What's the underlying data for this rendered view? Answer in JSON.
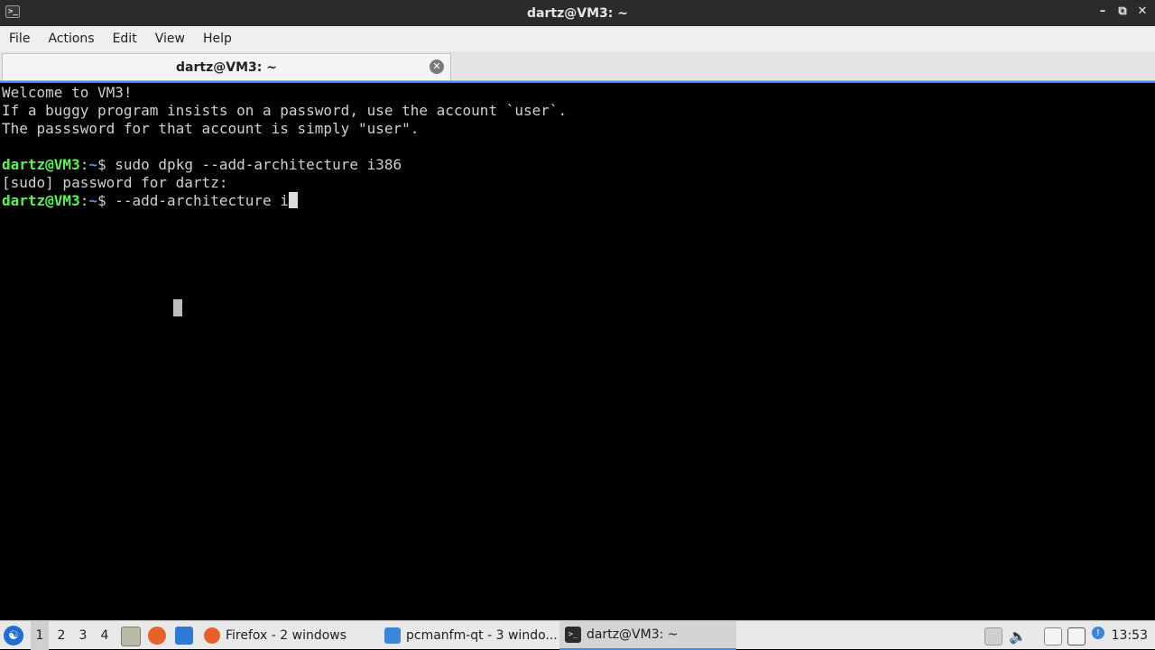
{
  "window": {
    "title": "dartz@VM3: ~",
    "icon": "terminal-icon",
    "controls": [
      "minimize-icon",
      "restore-icon",
      "close-icon"
    ]
  },
  "menu": {
    "file": "File",
    "actions": "Actions",
    "edit": "Edit",
    "view": "View",
    "help": "Help"
  },
  "tab": {
    "label": "dartz@VM3: ~",
    "close_icon": "close-circle-icon"
  },
  "terminal": {
    "lines": [
      "Welcome to VM3!",
      "If a buggy program insists on a password, use the account `user`.",
      "The passsword for that account is simply \"user\".",
      ""
    ],
    "prompt_user": "dartz@VM3",
    "prompt_sep": ":",
    "prompt_path": "~",
    "prompt_end": "$",
    "command1": " sudo dpkg --add-architecture i386",
    "sudo_line": "[sudo] password for dartz:",
    "command2": " --add-architecture i",
    "colors": {
      "user": "#5df25d",
      "path": "#5a8fff",
      "text": "#d0d0d0",
      "background": "#000000"
    }
  },
  "taskbar": {
    "desktops": [
      "1",
      "2",
      "3",
      "4"
    ],
    "tasks": [
      {
        "label": "Firefox - 2 windows",
        "icon": "firefox-icon"
      },
      {
        "label": "pcmanfm-qt - 3 windo...",
        "icon": "folder-icon"
      },
      {
        "label": "dartz@VM3: ~",
        "icon": "terminal-icon"
      }
    ],
    "clock": "13:53",
    "accent": "#3d8ee8"
  }
}
